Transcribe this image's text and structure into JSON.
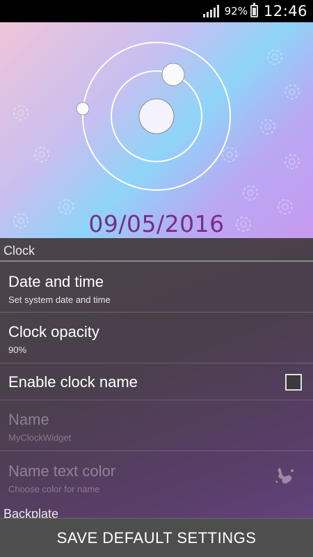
{
  "status_bar": {
    "battery_percent": "92%",
    "time": "12:46"
  },
  "hero": {
    "date": "09/05/2016"
  },
  "section": {
    "title": "Clock"
  },
  "preferences": {
    "date_time": {
      "title": "Date and time",
      "summary": "Set system date and time"
    },
    "opacity": {
      "title": "Clock opacity",
      "summary": "90%"
    },
    "enable_name": {
      "title": "Enable clock name",
      "checked": false
    },
    "name": {
      "title": "Name",
      "summary": "MyClockWidget"
    },
    "name_color": {
      "title": "Name text color",
      "summary": "Choose color for name"
    }
  },
  "next_section": {
    "title": "Backplate"
  },
  "footer": {
    "save_label": "SAVE DEFAULT SETTINGS"
  }
}
